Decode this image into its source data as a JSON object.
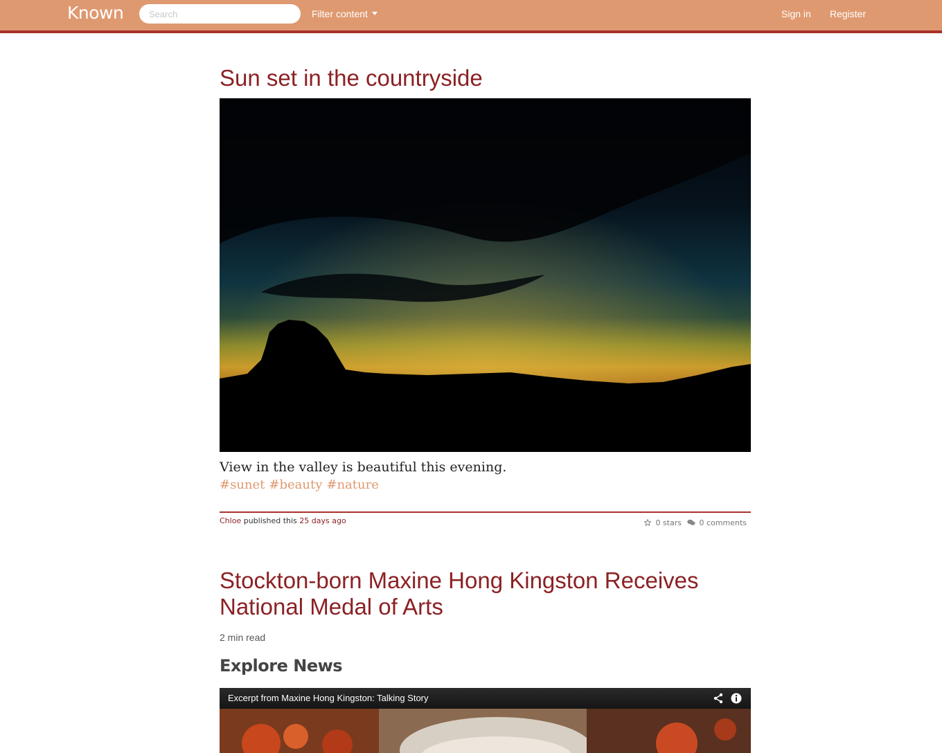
{
  "navbar": {
    "brand": "Known",
    "search_placeholder": "Search",
    "filter_label": "Filter content",
    "signin_label": "Sign in",
    "register_label": "Register"
  },
  "posts": [
    {
      "title": "Sun set in the countryside",
      "caption": "View in the valley is beautiful this evening.",
      "tags": [
        "#sunet",
        "#beauty",
        "#nature"
      ],
      "author": "Chloe",
      "published_text": "published this",
      "time_ago": "25 days ago",
      "stars": "0 stars",
      "comments": "0 comments"
    },
    {
      "title": "Stockton-born Maxine Hong Kingston Receives National Medal of Arts",
      "read_time": "2 min read",
      "section_heading": "Explore News",
      "video_title": "Excerpt from Maxine Hong Kingston: Talking Story"
    }
  ],
  "colors": {
    "navbar_bg": "#df9970",
    "accent_dark": "#a8322a",
    "title_red": "#8b2124",
    "tag_orange": "#df9970"
  }
}
